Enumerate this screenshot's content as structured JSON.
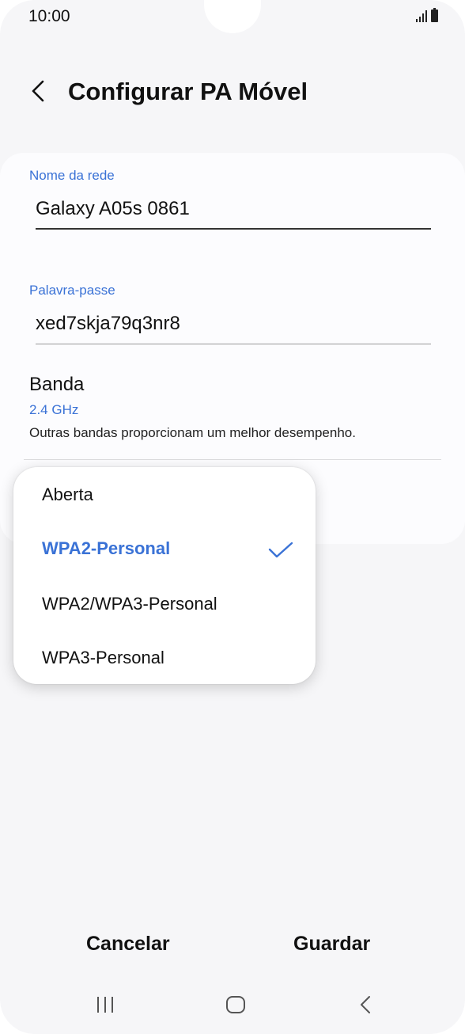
{
  "status_bar": {
    "time": "10:00"
  },
  "header": {
    "title": "Configurar PA Móvel"
  },
  "network_name": {
    "label": "Nome da rede",
    "value": "Galaxy A05s 0861"
  },
  "password": {
    "label": "Palavra-passe",
    "value": "xed7skja79q3nr8"
  },
  "band": {
    "title": "Banda",
    "value": "2.4 GHz",
    "description": "Outras bandas proporcionam um melhor desempenho."
  },
  "security_menu": {
    "options": [
      "Aberta",
      "WPA2-Personal",
      "WPA2/WPA3-Personal",
      "WPA3-Personal"
    ],
    "selected": "WPA2-Personal"
  },
  "footer": {
    "cancel_label": "Cancelar",
    "save_label": "Guardar"
  },
  "colors": {
    "accent": "#3a72d6",
    "background": "#f6f6f8",
    "card": "#fcfcfe"
  }
}
